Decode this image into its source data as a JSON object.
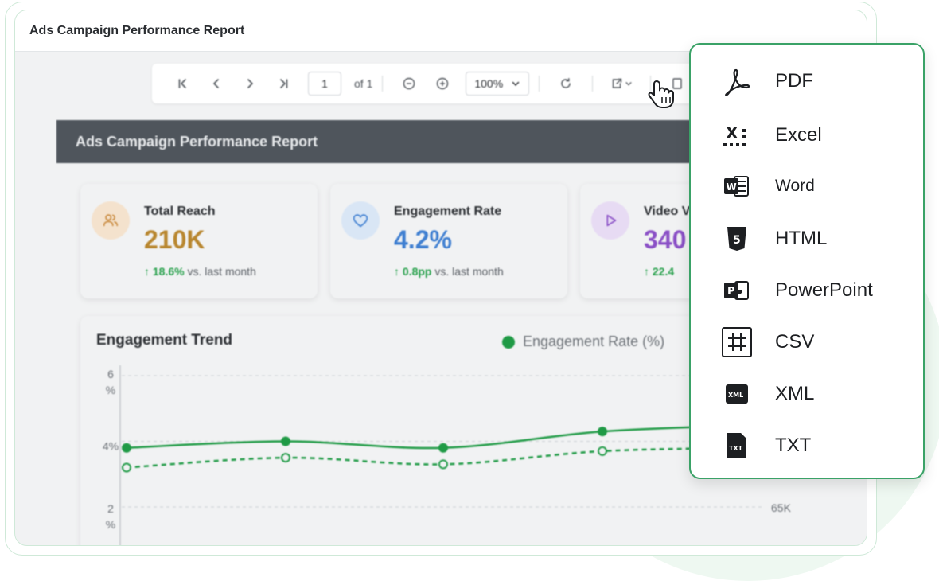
{
  "window": {
    "title": "Ads Campaign Performance Report"
  },
  "toolbar": {
    "page": "1",
    "page_of": "of 1",
    "zoom": "100%"
  },
  "report": {
    "title": "Ads Campaign Performance Report"
  },
  "kpis": [
    {
      "label": "Total Reach",
      "value": "210K",
      "change": "18.6%",
      "suffix": "vs. last month",
      "color": "#b8862e"
    },
    {
      "label": "Engagement Rate",
      "value": "4.2%",
      "change": "0.8pp",
      "suffix": "vs. last month",
      "color": "#3f7fd1"
    },
    {
      "label": "Video V",
      "value": "340",
      "change": "22.4",
      "suffix": "",
      "color": "#8a4fc6"
    }
  ],
  "trend": {
    "title": "Engagement Trend",
    "legend": "Engagement Rate (%)",
    "y_left_labels": [
      "6",
      "%",
      "4%",
      "2",
      "%"
    ],
    "y_right_label": "65K"
  },
  "chart_data": {
    "type": "line",
    "title": "Engagement Trend",
    "ylim": [
      2,
      6
    ],
    "grid": true,
    "legend_position": "top-right",
    "series": [
      {
        "name": "Engagement Rate (%)",
        "style": "solid",
        "color": "#1f9a45",
        "values": [
          3.8,
          4.0,
          3.8,
          4.3,
          4.5
        ]
      },
      {
        "style": "dashed",
        "color": "#1f9a45",
        "values": [
          3.2,
          3.5,
          3.3,
          3.7,
          3.8
        ]
      }
    ]
  },
  "export_menu": {
    "items": [
      {
        "label": "PDF",
        "icon": "pdf-icon"
      },
      {
        "label": "Excel",
        "icon": "excel-icon"
      },
      {
        "label": "Word",
        "icon": "word-icon"
      },
      {
        "label": "HTML",
        "icon": "html-icon"
      },
      {
        "label": "PowerPoint",
        "icon": "powerpoint-icon"
      },
      {
        "label": "CSV",
        "icon": "csv-icon"
      },
      {
        "label": "XML",
        "icon": "xml-icon"
      },
      {
        "label": "TXT",
        "icon": "txt-icon"
      }
    ]
  },
  "colors": {
    "accent_green": "#1f9a45",
    "frame_green": "#3aa267",
    "banner": "#4f555c"
  }
}
